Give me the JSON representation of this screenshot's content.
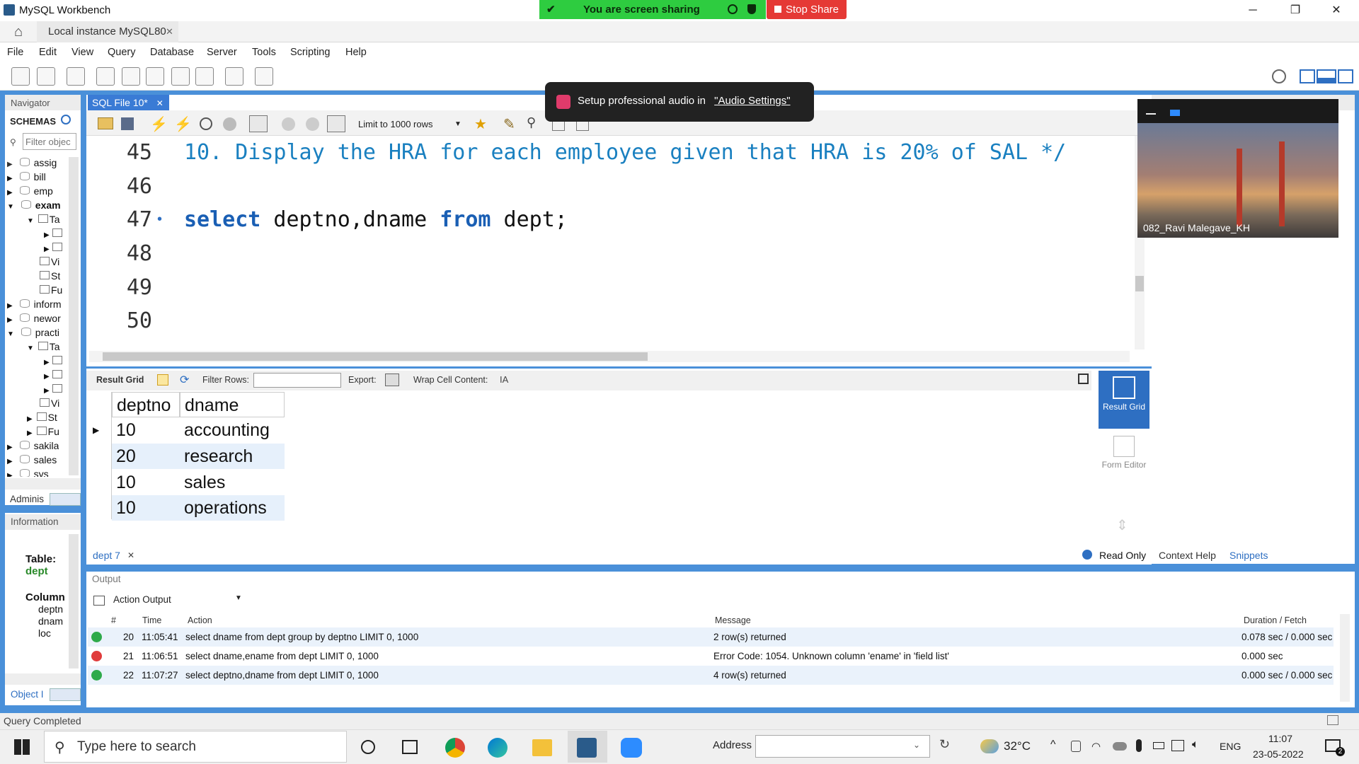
{
  "window": {
    "title": "MySQL Workbench",
    "minimize": "─",
    "maximize": "❐",
    "close": "✕"
  },
  "share": {
    "banner": "You are screen sharing",
    "stop": "Stop Share"
  },
  "tabs": {
    "instance": "Local instance MySQL80",
    "instance_close": "✕"
  },
  "menu": [
    "File",
    "Edit",
    "View",
    "Query",
    "Database",
    "Server",
    "Tools",
    "Scripting",
    "Help"
  ],
  "navigator": {
    "title": "Navigator",
    "schemas_label": "SCHEMAS",
    "filter_placeholder": "Filter objec",
    "rows": [
      "assig",
      "bill",
      "emp",
      "exam",
      "Ta",
      "",
      "",
      "Vi",
      "St",
      "Fu",
      "inform",
      "newor",
      "practi",
      "Ta",
      "",
      "",
      "",
      "Vi",
      "St",
      "Fu",
      "sakila",
      "sales",
      "sys"
    ],
    "admin_tab": "Adminis"
  },
  "info": {
    "title": "Information",
    "table_label": "Table:",
    "table_name": "dept",
    "columns_label": "Column",
    "columns": [
      "deptn",
      "dnam",
      "loc"
    ],
    "object_tab": "Object I"
  },
  "editor": {
    "file_tab": "SQL File 10*",
    "limit": "Limit to 1000 rows",
    "lines": [
      {
        "num": "45",
        "text": "10. Display the HRA for each employee given that HRA is 20% of SAL */"
      },
      {
        "num": "46",
        "text": ""
      },
      {
        "num": "47",
        "kw1": "select",
        "mid": " deptno,dname ",
        "kw2": "from",
        "tail": " dept;"
      },
      {
        "num": "48",
        "text": ""
      },
      {
        "num": "49",
        "text": ""
      },
      {
        "num": "50",
        "text": ""
      }
    ]
  },
  "audio_popup": {
    "text": "Setup professional audio in",
    "link": "\"Audio Settings\""
  },
  "video": {
    "name": "082_Ravi Malegave_KH"
  },
  "results": {
    "toolbar": {
      "result_grid": "Result Grid",
      "filter_rows": "Filter Rows:",
      "export": "Export:",
      "wrap": "Wrap Cell Content:"
    },
    "columns": [
      "deptno",
      "dname"
    ],
    "rows": [
      [
        "10",
        "accounting"
      ],
      [
        "20",
        "research"
      ],
      [
        "10",
        "sales"
      ],
      [
        "10",
        "operations"
      ]
    ],
    "tab": "dept 7",
    "read_only": "Read Only",
    "side_result_grid": "Result Grid",
    "side_form_editor": "Form Editor"
  },
  "side": {
    "context_help": "Context Help",
    "snippets": "Snippets"
  },
  "output": {
    "title": "Output",
    "mode": "Action Output",
    "headers": [
      "#",
      "Time",
      "Action",
      "Message",
      "Duration / Fetch"
    ],
    "rows": [
      {
        "status": "ok",
        "num": "20",
        "time": "11:05:41",
        "action": "select dname from dept  group by deptno LIMIT 0, 1000",
        "message": "2 row(s) returned",
        "duration": "0.078 sec / 0.000 sec"
      },
      {
        "status": "err",
        "num": "21",
        "time": "11:06:51",
        "action": "select dname,ename from dept LIMIT 0, 1000",
        "message": "Error Code: 1054. Unknown column 'ename' in 'field list'",
        "duration": "0.000 sec"
      },
      {
        "status": "ok",
        "num": "22",
        "time": "11:07:27",
        "action": "select deptno,dname from dept LIMIT 0, 1000",
        "message": "4 row(s) returned",
        "duration": "0.000 sec / 0.000 sec"
      }
    ]
  },
  "status": {
    "text": "Query Completed"
  },
  "taskbar": {
    "search_placeholder": "Type here to search",
    "address_label": "Address",
    "temp": "32°C",
    "lang": "ENG",
    "time": "11:07",
    "date": "23-05-2022",
    "notif_count": "2"
  }
}
